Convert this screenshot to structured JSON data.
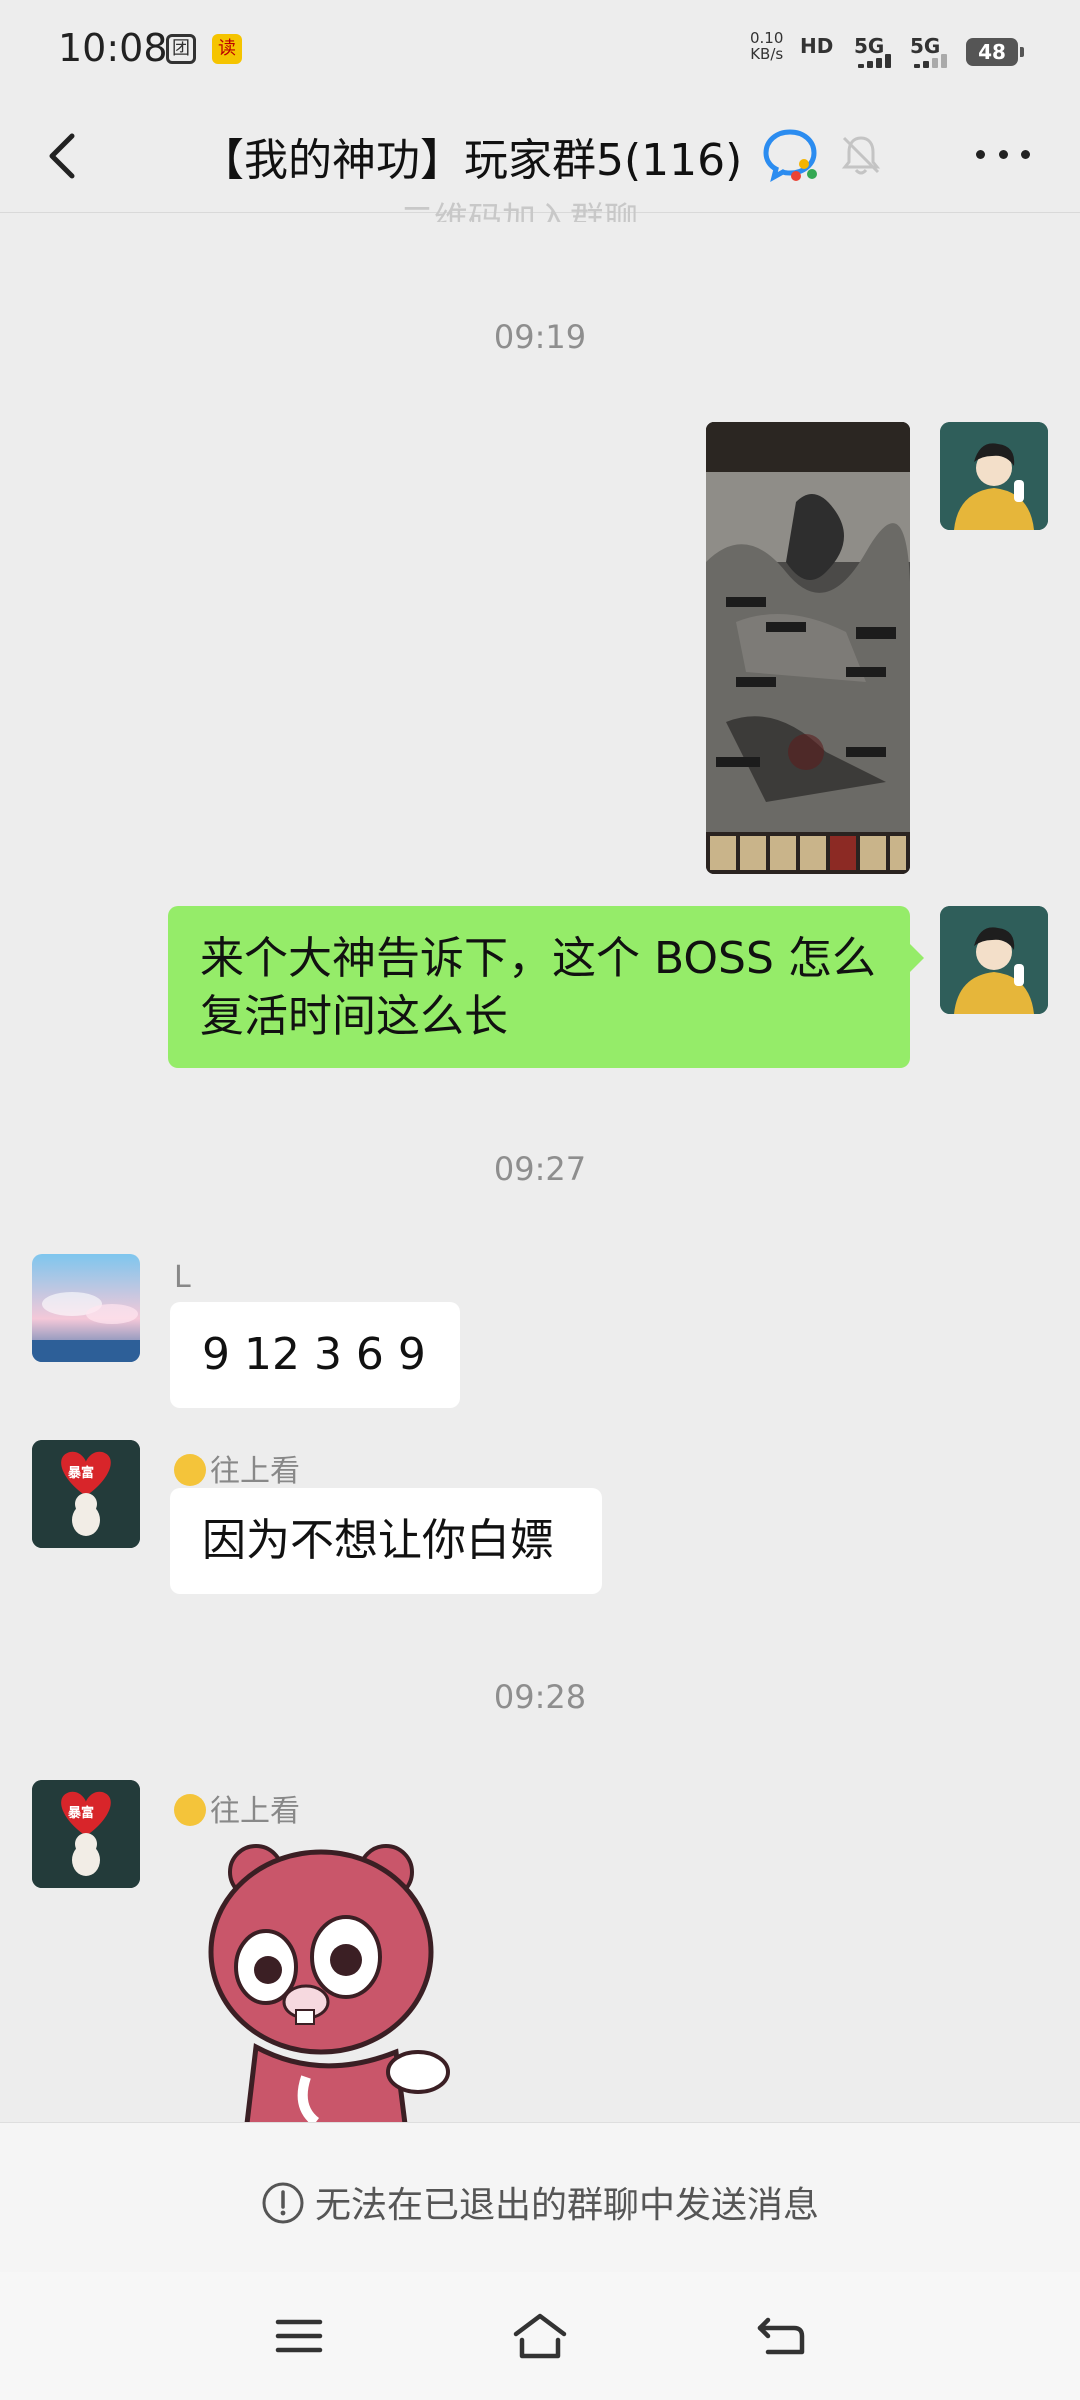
{
  "status": {
    "time": "10:08",
    "net_speed": "0.10",
    "net_unit": "KB/s",
    "hd": "HD",
    "sim1": "5G",
    "sim2": "5G",
    "battery": "48",
    "app_icon_1": "团",
    "app_icon_2": "读"
  },
  "header": {
    "title": "【我的神功】玩家群5(116)",
    "faded_text": "二维码加入群聊"
  },
  "messages": {
    "t1": "09:19",
    "m2": "来个大神告诉下，这个 BOSS 怎么复活时间这么长",
    "t2": "09:27",
    "m3_sender": "L",
    "m3": "9 12  3 6 9",
    "m4_sender": "往上看",
    "m4": "因为不想让你白嫖",
    "t3": "09:28",
    "m5_sender": "往上看",
    "avatar_label": "暴富"
  },
  "footer": {
    "notice": "无法在已退出的群聊中发送消息"
  },
  "colors": {
    "green_bubble": "#95ec69",
    "background": "#ededed"
  }
}
